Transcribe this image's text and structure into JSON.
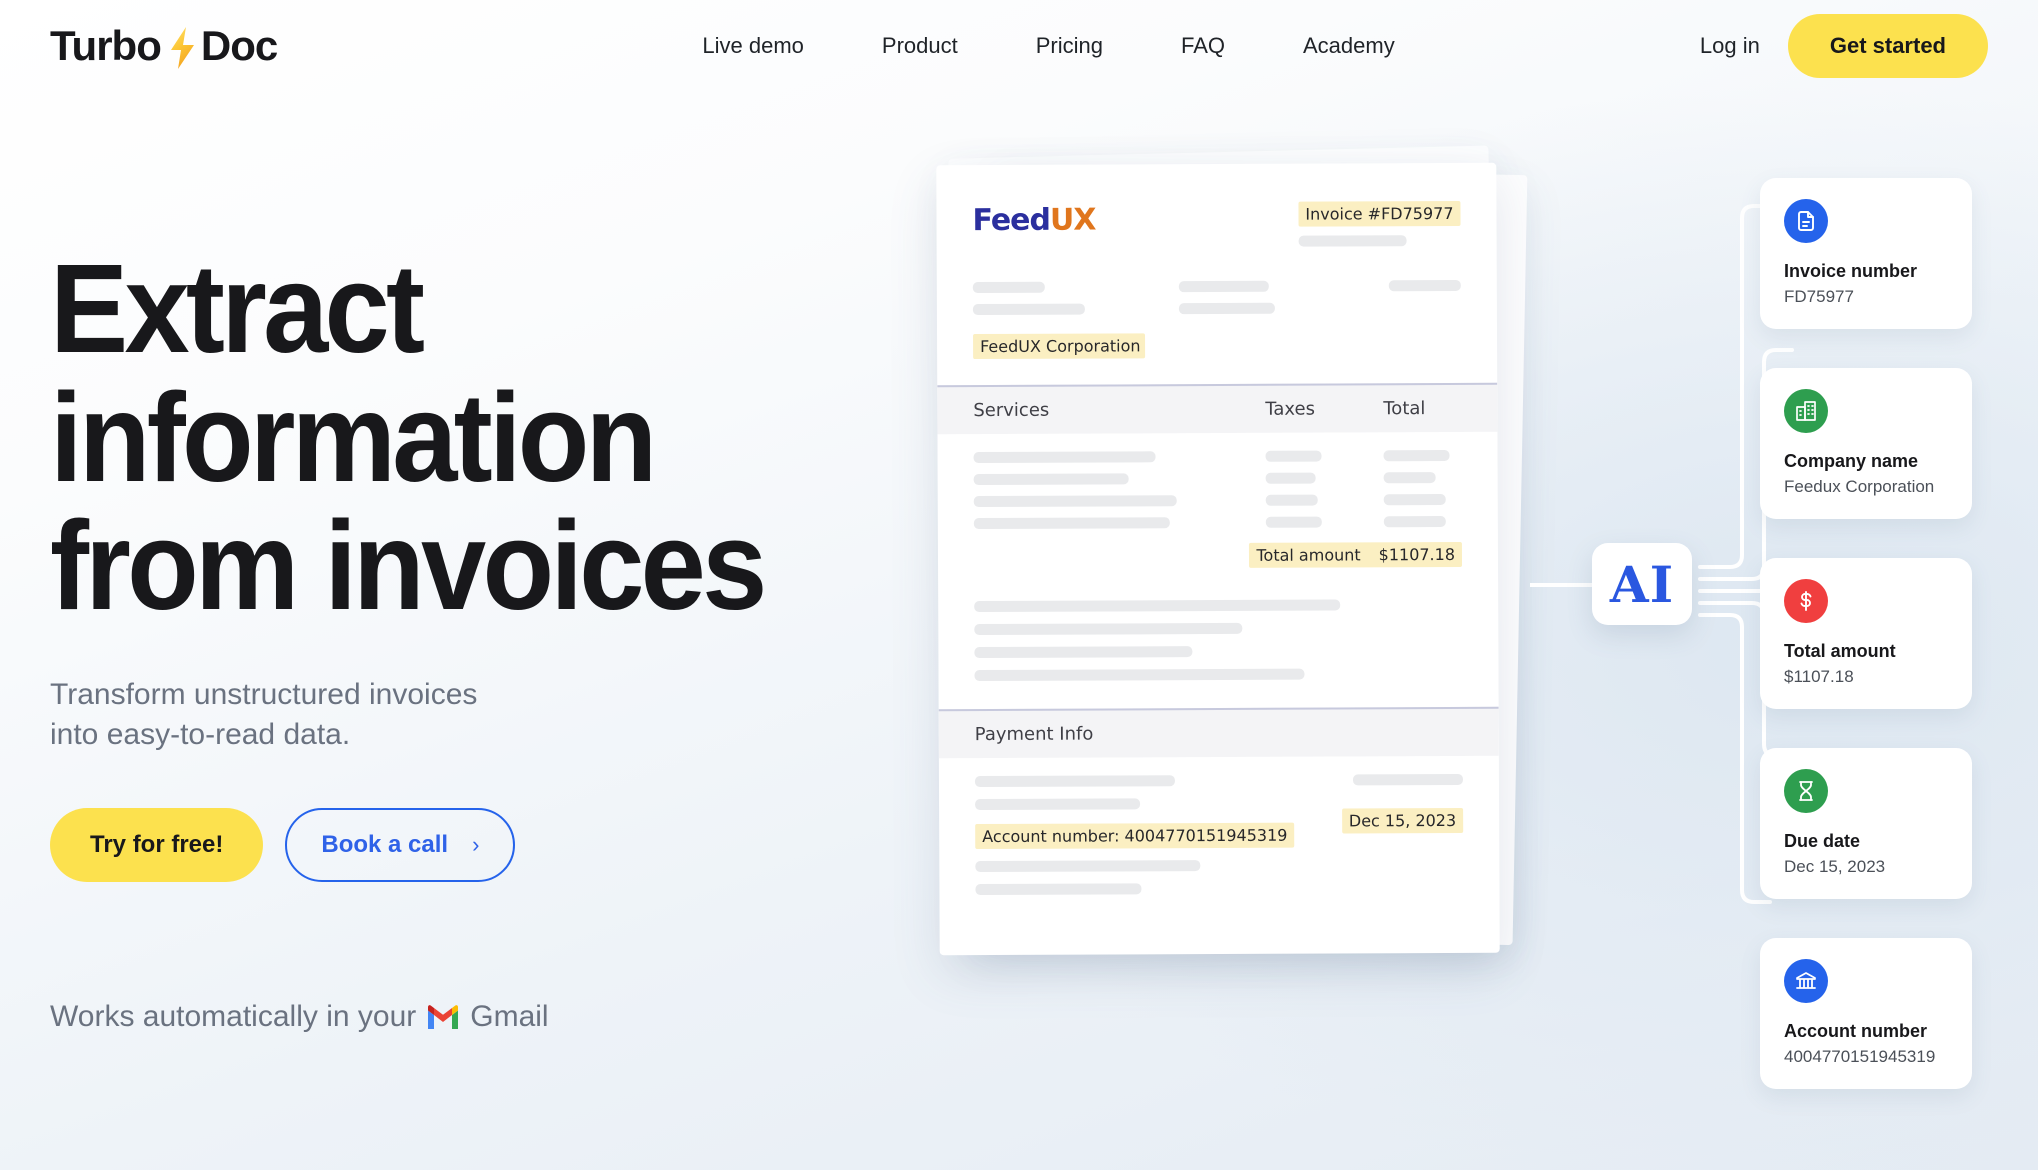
{
  "brand": {
    "name_before": "Turbo",
    "bolt_icon": "lightning-bolt-icon",
    "name_after": "Doc"
  },
  "nav": {
    "items": [
      {
        "label": "Live demo"
      },
      {
        "label": "Product"
      },
      {
        "label": "Pricing"
      },
      {
        "label": "FAQ"
      },
      {
        "label": "Academy"
      }
    ],
    "login_label": "Log in",
    "get_started_label": "Get started"
  },
  "hero": {
    "headline_line1": "Extract",
    "headline_line2": "information",
    "headline_line3": "from invoices",
    "subtitle_line1": "Transform unstructured invoices",
    "subtitle_line2": "into easy-to-read data.",
    "primary_cta": "Try for free!",
    "secondary_cta": "Book a call",
    "secondary_cta_chevron": "›",
    "gmail_prefix": "Works automatically in your",
    "gmail_label": "Gmail"
  },
  "document": {
    "logo_part1": "Feed",
    "logo_part2": "UX",
    "invoice_number_highlight": "Invoice #FD75977",
    "company_highlight": "FeedUX Corporation",
    "table_headers": {
      "services": "Services",
      "taxes": "Taxes",
      "total": "Total"
    },
    "total_label": "Total amount",
    "total_value": "$1107.18",
    "payment_section_title": "Payment Info",
    "account_highlight": "Account number: 4004770151945319",
    "date_highlight": "Dec 15, 2023"
  },
  "ai_badge": {
    "label": "AI"
  },
  "extraction_cards": [
    {
      "icon": "document-icon",
      "icon_color": "#2563eb",
      "title": "Invoice number",
      "value": "FD75977"
    },
    {
      "icon": "building-icon",
      "icon_color": "#2e9e4f",
      "title": "Company name",
      "value": "Feedux Corporation"
    },
    {
      "icon": "dollar-icon",
      "icon_color": "#f03f3f",
      "title": "Total amount",
      "value": "$1107.18"
    },
    {
      "icon": "hourglass-icon",
      "icon_color": "#2e9e4f",
      "title": "Due date",
      "value": "Dec 15, 2023"
    },
    {
      "icon": "bank-icon",
      "icon_color": "#2563eb",
      "title": "Account number",
      "value": "4004770151945319"
    }
  ],
  "colors": {
    "accent_yellow": "#FCE14E",
    "accent_blue": "#2563eb",
    "highlight_yellow": "#FBEFC2",
    "page_background": "#E4EBF3"
  }
}
